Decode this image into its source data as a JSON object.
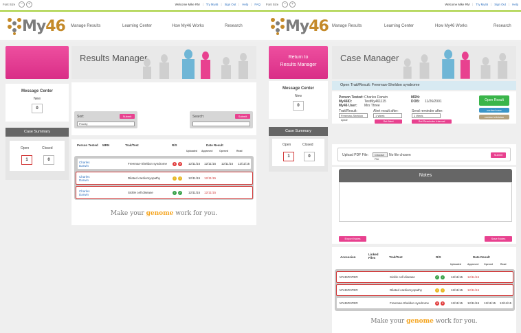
{
  "left": {
    "topbar": {
      "font_size": "Font Size",
      "minus": "–",
      "plus": "+",
      "welcome": "Welcome Mike RM",
      "try": "Try My46",
      "signout": "Sign Out",
      "help": "Help",
      "faq": "FAQ"
    },
    "logo": {
      "part1": "My",
      "part2": "46"
    },
    "nav": [
      "Manage Results",
      "Learning Center",
      "How My46 Works",
      "Research"
    ],
    "banner_title": "Results Manager",
    "message_center": {
      "title": "Message Center",
      "new_label": "New",
      "new_count": "0"
    },
    "case_summary": {
      "title": "Case Summary",
      "open_label": "Open",
      "closed_label": "Closed",
      "open_count": "1",
      "closed_count": "0"
    },
    "sort": {
      "label": "Sort:",
      "submit": "Submit",
      "value": "Priority"
    },
    "search": {
      "label": "Search:",
      "submit": "Submit"
    },
    "table": {
      "headers": [
        "Person Tested",
        "MRN",
        "Trait/Test",
        "R/S",
        "Date Result"
      ],
      "subheaders": [
        "Uploaded",
        "Approved",
        "Opened",
        "Read"
      ],
      "rows": [
        {
          "person": "Charles Darwin",
          "trait": "Freeman-Sheldon syndrome",
          "r": "red",
          "s": "red",
          "uploaded": "12/11/15",
          "approved": "12/11/15",
          "opened": "12/11/15",
          "read": "12/11/15"
        },
        {
          "person": "Charles Darwin",
          "trait": "Dilated cardiomyopathy",
          "r": "yellow",
          "s": "yellow",
          "uploaded": "12/11/15",
          "approved": "12/11/15",
          "opened": "",
          "read": ""
        },
        {
          "person": "Charles Darwin",
          "trait": "Sickle cell disease",
          "r": "green",
          "s": "green",
          "uploaded": "12/11/15",
          "approved": "12/11/15",
          "opened": "",
          "read": ""
        }
      ]
    },
    "tagline": {
      "pre": "Make your ",
      "accent": "genome",
      "post": " work for you."
    }
  },
  "right": {
    "topbar": {
      "font_size": "Font Size",
      "minus": "–",
      "plus": "+",
      "welcome": "Welcome Mike RM",
      "try": "Try My46",
      "signout": "Sign Out",
      "help": "Help"
    },
    "logo": {
      "part1": "My",
      "part2": "46"
    },
    "nav": [
      "Manage Results",
      "Learning Center",
      "How My46 Works",
      "Research"
    ],
    "return_line1": "Return to",
    "return_line2": "Results Manager",
    "banner_title": "Case Manager",
    "message_center": {
      "title": "Message Center",
      "new_label": "New",
      "new_count": "0"
    },
    "case_summary": {
      "title": "Case Summary",
      "open_label": "Open",
      "closed_label": "Closed",
      "open_count": "1",
      "closed_count": "0"
    },
    "open_trait": "Open Trait/Result: Freeman-Sheldon syndrome",
    "person": {
      "tested_label": "Person Tested:",
      "tested": "Charles Darwin",
      "id_label": "My46ID:",
      "id": "TestMy461115",
      "user_label": "My46 User:",
      "user": "Mrs Three",
      "mrn_label": "MRN:",
      "mrn": "",
      "dob_label": "DOB:",
      "dob": "11/26/2001"
    },
    "buttons": {
      "open_result": "Open Result",
      "contact_user": "contact user",
      "contact_clinician": "contact clinician"
    },
    "alert": {
      "trait_label": "Trait/Result:",
      "trait_value": "Freeman-Sheldon syndr",
      "alert_label": "Alert result after:",
      "alert_value": "1 Week",
      "set_alert": "Set Alert",
      "reminder_label": "Send reminder after:",
      "reminder_value": "1 Week",
      "set_reminder": "Set Reminder Interval"
    },
    "upload": {
      "label": "Upload PDF File:",
      "choose": "Choose File",
      "no_file": "No file chosen",
      "submit": "Submit"
    },
    "notes": {
      "title": "Notes",
      "export": "Export Notes",
      "save": "Save Notes"
    },
    "table": {
      "headers": [
        "Accession",
        "Linked Files",
        "Trait/Test",
        "R/S",
        "Date Result"
      ],
      "subheaders": [
        "Uploaded",
        "Approved",
        "Opened",
        "Read"
      ],
      "rows": [
        {
          "accession": "MY46PAPER",
          "trait": "Sickle cell disease",
          "uploaded": "12/11/15",
          "approved": "12/11/15",
          "opened": "",
          "read": ""
        },
        {
          "accession": "MY46PAPER",
          "trait": "Dilated cardiomyopathy",
          "uploaded": "12/11/15",
          "approved": "12/11/15",
          "opened": "",
          "read": ""
        },
        {
          "accession": "MY46PAPER",
          "trait": "Freeman-Sheldon syndrome",
          "uploaded": "12/11/15",
          "approved": "12/11/15",
          "opened": "12/11/15",
          "read": "12/11/15"
        }
      ]
    },
    "tagline": {
      "pre": "Make your ",
      "accent": "genome",
      "post": " work for you."
    }
  }
}
